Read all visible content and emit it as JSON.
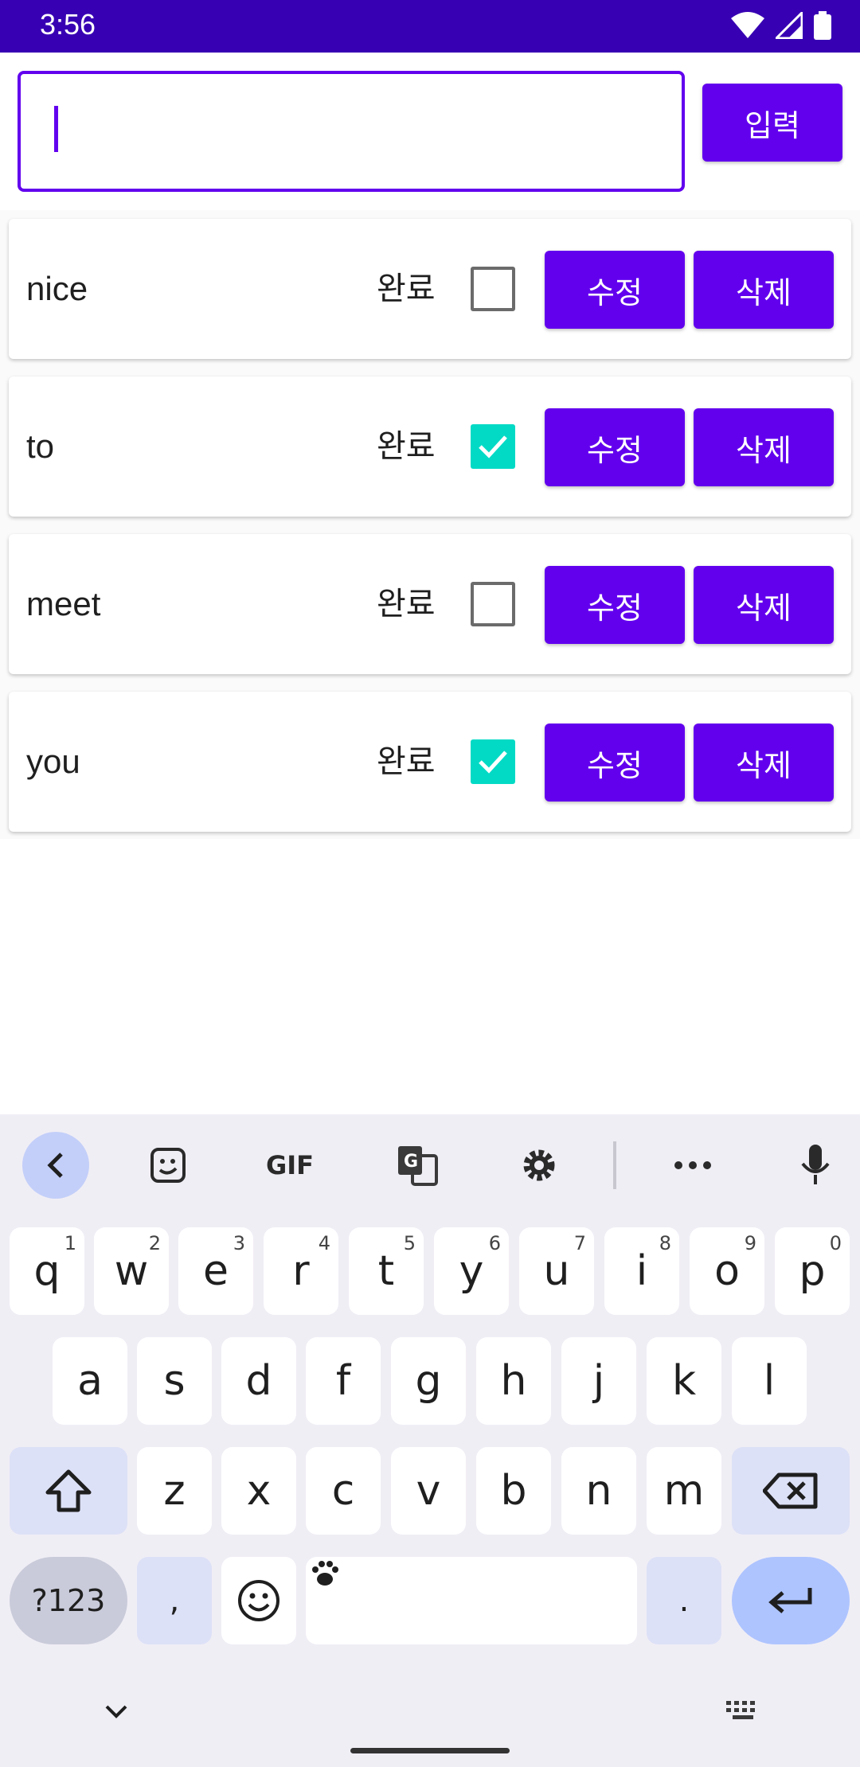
{
  "status_bar": {
    "time": "3:56"
  },
  "input": {
    "value": "",
    "button_label": "입력"
  },
  "todos": [
    {
      "text": "nice",
      "done_label": "완료",
      "checked": false,
      "edit_label": "수정",
      "delete_label": "삭제"
    },
    {
      "text": "to",
      "done_label": "완료",
      "checked": true,
      "edit_label": "수정",
      "delete_label": "삭제"
    },
    {
      "text": "meet",
      "done_label": "완료",
      "checked": false,
      "edit_label": "수정",
      "delete_label": "삭제"
    },
    {
      "text": "you",
      "done_label": "완료",
      "checked": true,
      "edit_label": "수정",
      "delete_label": "삭제"
    }
  ],
  "colors": {
    "primary": "#6200ee",
    "status_bar": "#3700b3",
    "check_accent": "#03dac5"
  },
  "keyboard": {
    "toolbar": [
      "back-chevron-icon",
      "sticker-icon",
      "GIF",
      "translate-icon",
      "settings-gear-icon",
      "more-dots-icon",
      "microphone-icon"
    ],
    "row1": [
      {
        "k": "q",
        "h": "1"
      },
      {
        "k": "w",
        "h": "2"
      },
      {
        "k": "e",
        "h": "3"
      },
      {
        "k": "r",
        "h": "4"
      },
      {
        "k": "t",
        "h": "5"
      },
      {
        "k": "y",
        "h": "6"
      },
      {
        "k": "u",
        "h": "7"
      },
      {
        "k": "i",
        "h": "8"
      },
      {
        "k": "o",
        "h": "9"
      },
      {
        "k": "p",
        "h": "0"
      }
    ],
    "row2": [
      "a",
      "s",
      "d",
      "f",
      "g",
      "h",
      "j",
      "k",
      "l"
    ],
    "row3": [
      "z",
      "x",
      "c",
      "v",
      "b",
      "n",
      "m"
    ],
    "symbols_label": "?123",
    "comma": ",",
    "period": "."
  }
}
